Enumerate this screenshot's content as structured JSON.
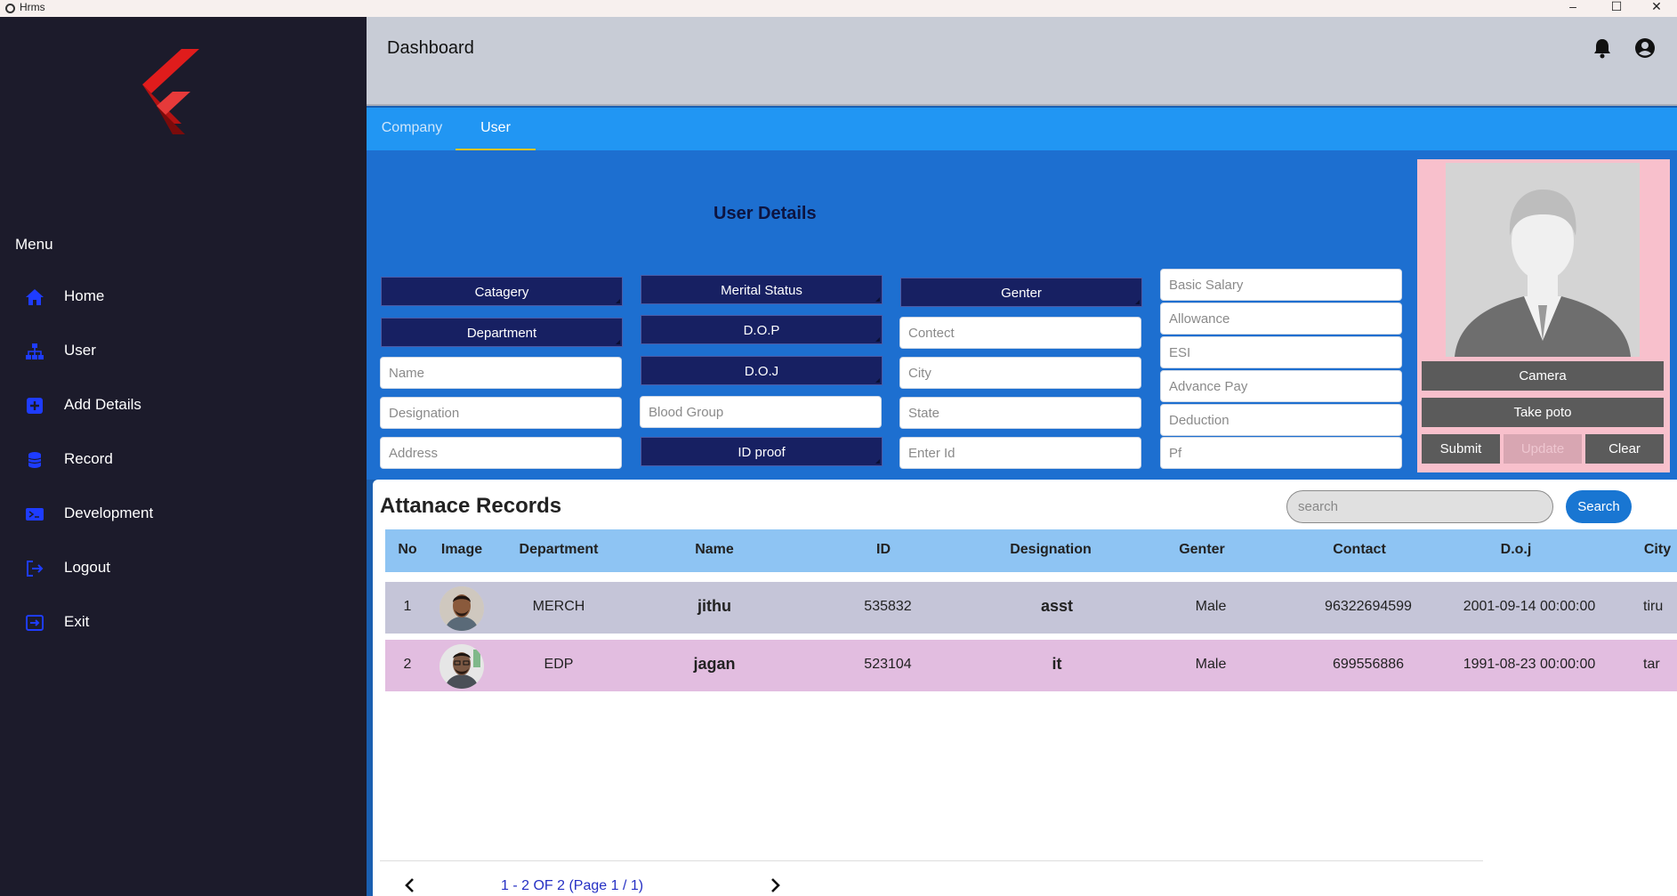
{
  "window": {
    "title": "Hrms",
    "minimize_label": "–",
    "maximize_label": "☐",
    "close_label": "✕"
  },
  "sidebar": {
    "menu_heading": "Menu",
    "items": [
      {
        "label": "Home",
        "icon": "home-icon"
      },
      {
        "label": "User",
        "icon": "user-tree-icon"
      },
      {
        "label": "Add Details",
        "icon": "add-details-icon"
      },
      {
        "label": "Record",
        "icon": "record-icon"
      },
      {
        "label": "Development",
        "icon": "development-icon"
      },
      {
        "label": "Logout",
        "icon": "logout-icon"
      },
      {
        "label": "Exit",
        "icon": "exit-icon"
      }
    ]
  },
  "header": {
    "title": "Dashboard"
  },
  "tabs": [
    {
      "label": "Company",
      "active": false
    },
    {
      "label": "User",
      "active": true
    }
  ],
  "form": {
    "title": "User Details",
    "col1": {
      "category": "Catagery",
      "department": "Department",
      "name_placeholder": "Name",
      "designation_placeholder": "Designation",
      "address_placeholder": "Address"
    },
    "col2": {
      "marital_status": "Merital Status",
      "dop": "D.O.P",
      "doj": "D.O.J",
      "blood_group_placeholder": "Blood Group",
      "id_proof": "ID proof"
    },
    "col3": {
      "gender": "Genter",
      "contact_placeholder": "Contect",
      "city_placeholder": "City",
      "state_placeholder": "State",
      "enter_id_placeholder": "Enter Id"
    },
    "col4": {
      "basic_salary_placeholder": "Basic Salary",
      "allowance_placeholder": "Allowance",
      "esi_placeholder": "ESI",
      "advance_pay_placeholder": "Advance Pay",
      "deduction_placeholder": "Deduction",
      "pf_placeholder": "Pf"
    },
    "photo": {
      "camera_label": "Camera",
      "take_photo_label": "Take poto",
      "submit_label": "Submit",
      "update_label": "Update",
      "clear_label": "Clear"
    }
  },
  "records": {
    "title": "Attanace Records",
    "search_placeholder": "search",
    "search_button": "Search",
    "columns": [
      "No",
      "Image",
      "Department",
      "Name",
      "ID",
      "Designation",
      "Genter",
      "Contact",
      "D.o.j",
      "City"
    ],
    "rows": [
      {
        "no": "1",
        "department": "MERCH",
        "name": "jithu",
        "id": "535832",
        "designation": "asst",
        "gender": "Male",
        "contact": "96322694599",
        "doj": "2001-09-14 00:00:00",
        "city": "tiru"
      },
      {
        "no": "2",
        "department": "EDP",
        "name": "jagan",
        "id": "523104",
        "designation": "it",
        "gender": "Male",
        "contact": "699556886",
        "doj": "1991-08-23 00:00:00",
        "city": "tar"
      }
    ],
    "pagination": "1 - 2 OF 2 (Page 1 / 1)"
  },
  "colors": {
    "sidebar_bg": "#1c1b2b",
    "tab_bar": "#2196f3",
    "form_bg": "#1d6fd0",
    "dropdown_bg": "#172062",
    "row1_bg": "#c5c5d8",
    "row2_bg": "#e2bde0",
    "table_header": "#8ec4f3",
    "photo_panel": "#f8c0cc",
    "nav_icon": "#1e3cff"
  }
}
